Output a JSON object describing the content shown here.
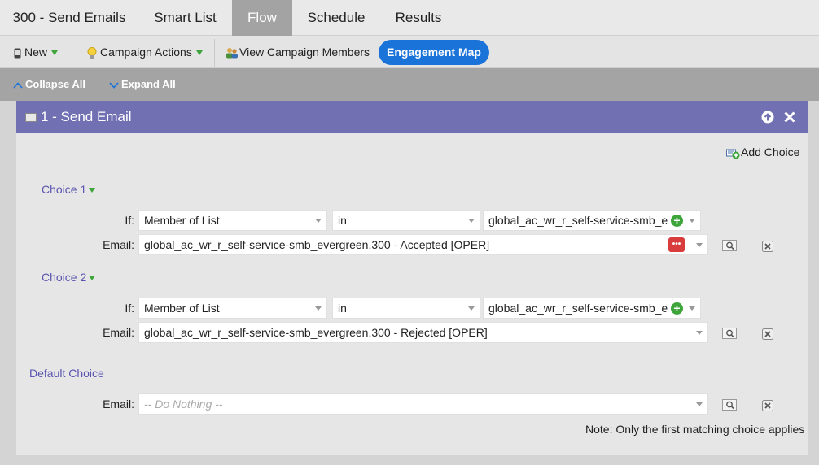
{
  "tabs": [
    {
      "label": "300 - Send Emails",
      "active": false
    },
    {
      "label": "Smart List",
      "active": false
    },
    {
      "label": "Flow",
      "active": true
    },
    {
      "label": "Schedule",
      "active": false
    },
    {
      "label": "Results",
      "active": false
    }
  ],
  "toolbar": {
    "new_label": "New",
    "campaign_actions_label": "Campaign Actions",
    "view_members_label": "View Campaign Members",
    "engagement_map_label": "Engagement Map"
  },
  "collapsebar": {
    "collapse_label": "Collapse All",
    "expand_label": "Expand All"
  },
  "step": {
    "title": "1 - Send Email",
    "add_choice_label": "Add Choice",
    "choices": [
      {
        "label": "Choice 1",
        "if_label": "If:",
        "condition": "Member of List",
        "operator": "in",
        "list_value": "global_ac_wr_r_self-service-smb_e",
        "email_label": "Email:",
        "email_value": "global_ac_wr_r_self-service-smb_evergreen.300 - Accepted [OPER]"
      },
      {
        "label": "Choice 2",
        "if_label": "If:",
        "condition": "Member of List",
        "operator": "in",
        "list_value": "global_ac_wr_r_self-service-smb_e",
        "email_label": "Email:",
        "email_value": "global_ac_wr_r_self-service-smb_evergreen.300 - Rejected [OPER]"
      }
    ],
    "default_choice": {
      "label": "Default Choice",
      "email_label": "Email:",
      "email_placeholder": "-- Do Nothing --"
    },
    "note": "Note: Only the first matching choice applies"
  },
  "colors": {
    "header_purple": "#7170b3",
    "accent_blue": "#1a73d9",
    "choice_label": "#5a55b0",
    "add_green": "#3da53a",
    "error_red": "#d93c3c"
  }
}
